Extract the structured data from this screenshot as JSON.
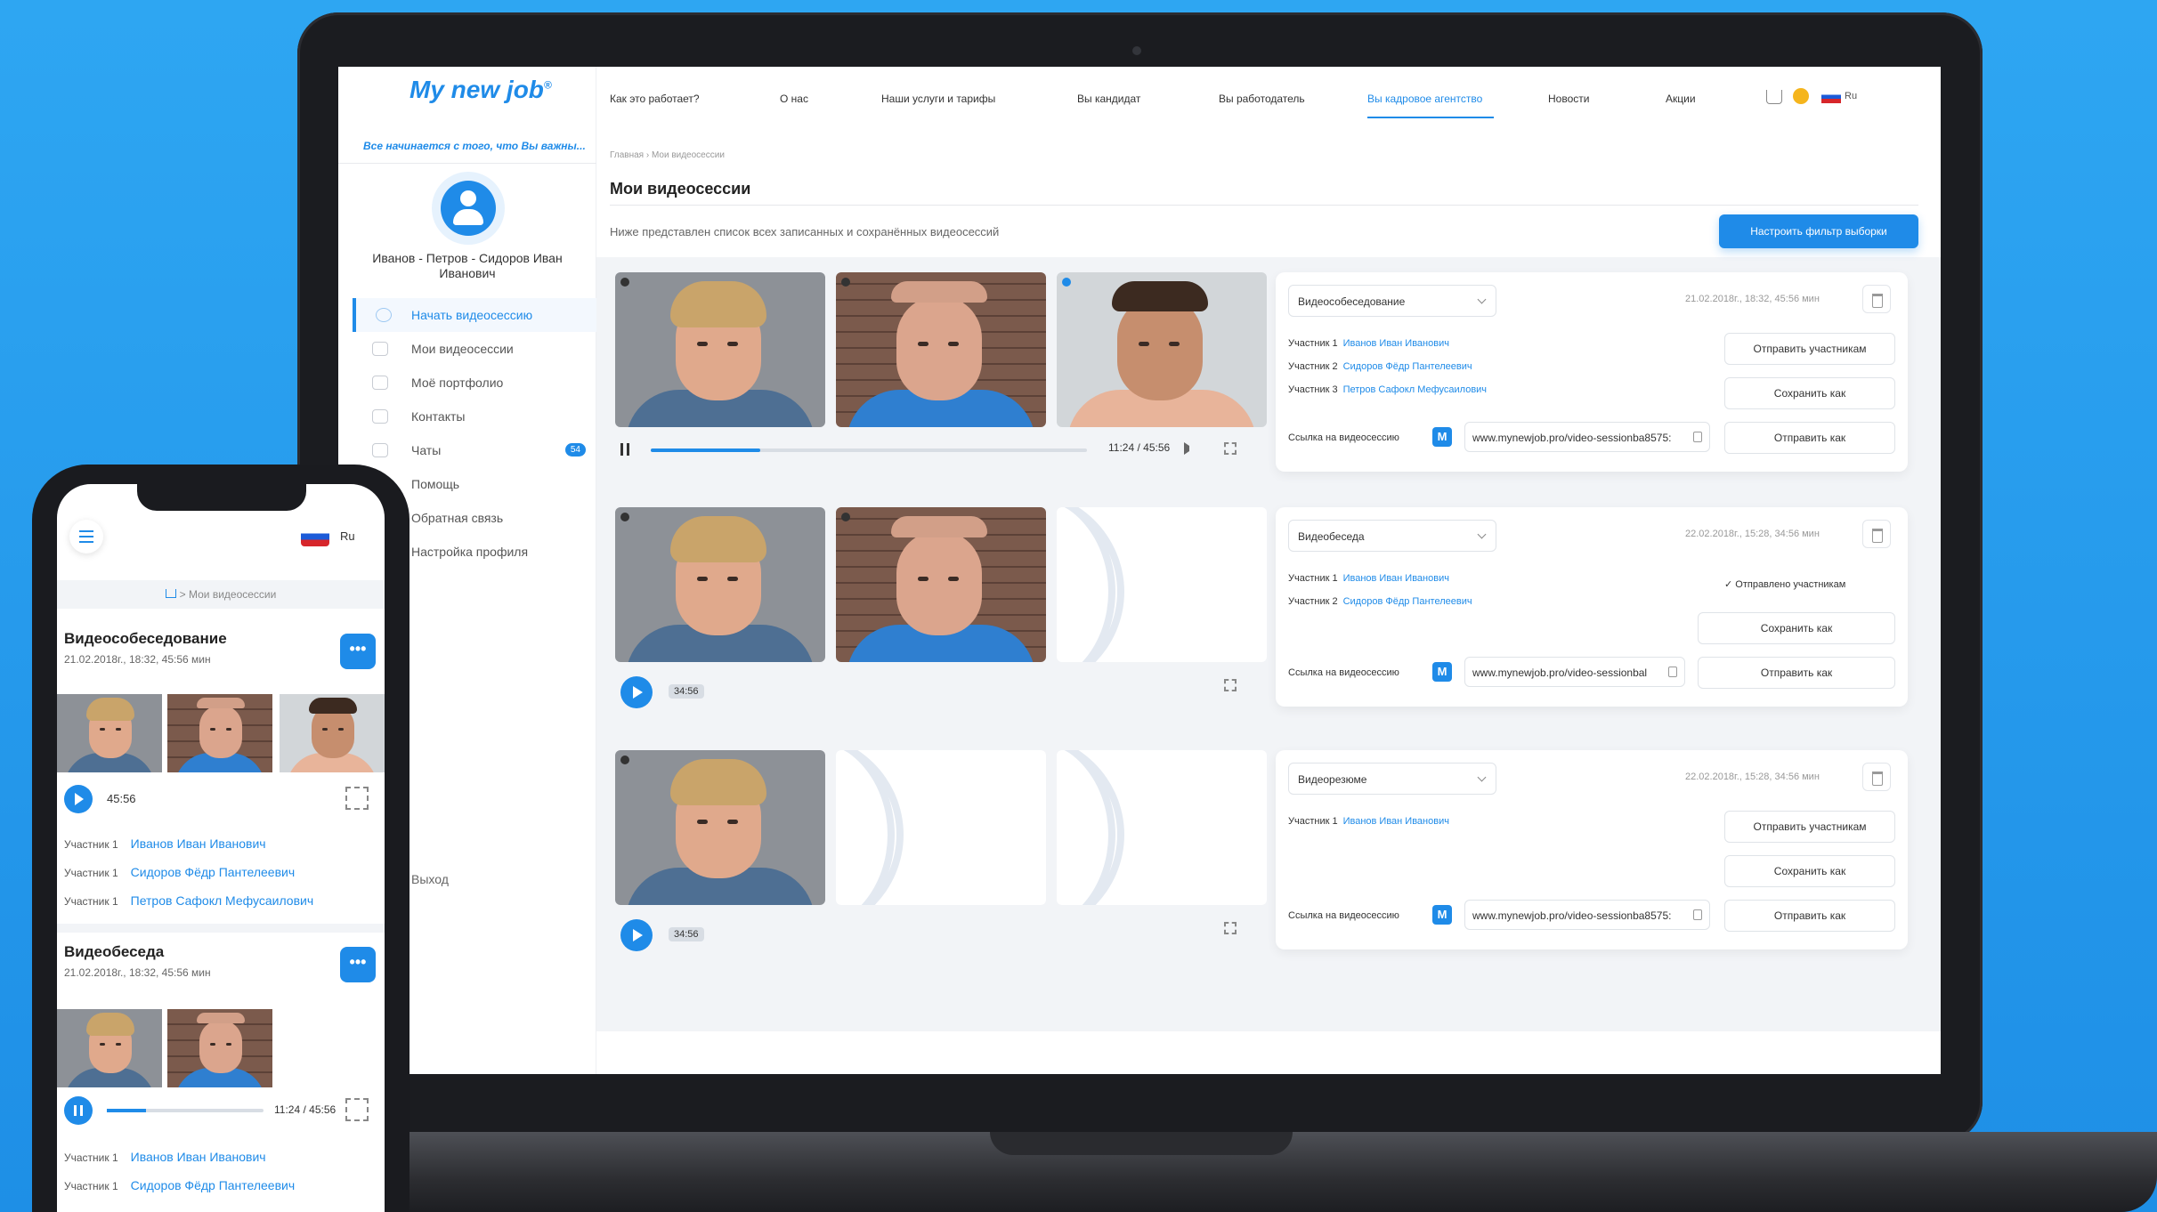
{
  "site": {
    "logo": "My new job",
    "slogan": "Все начинается с того, что Вы важны..."
  },
  "nav": {
    "items": [
      "Как это работает?",
      "О нас",
      "Наши услуги и тарифы",
      "Вы кандидат",
      "Вы работодатель",
      "Вы кадровое агентство",
      "Новости",
      "Акции"
    ],
    "active_index": 5,
    "lang": "Ru"
  },
  "sidebar": {
    "user_name": "Иванов - Петров - Сидоров Иван Иванович",
    "items": [
      {
        "label": "Начать видеосессию",
        "active": true
      },
      {
        "label": "Мои видеосессии"
      },
      {
        "label": "Моё портфолио"
      },
      {
        "label": "Контакты"
      },
      {
        "label": "Чаты",
        "badge": "54"
      },
      {
        "label": "Помощь"
      },
      {
        "label": "Обратная связь"
      },
      {
        "label": "Настройка профиля"
      }
    ],
    "logout": "Выход"
  },
  "page": {
    "breadcrumb": "Главная › Мои видеосессии",
    "title": "Мои видеосессии",
    "subtitle": "Ниже представлен список всех записанных и сохранённых видеосессий",
    "filter_button": "Настроить фильтр выборки"
  },
  "sessions": [
    {
      "type": "Видеособеседование",
      "date": "21.02.2018г., 18:32, 45:56 мин",
      "player": {
        "state": "playing",
        "time": "11:24 / 45:56",
        "progress": 0.25
      },
      "participants": [
        {
          "label": "Участник 1",
          "name": "Иванов Иван Иванович"
        },
        {
          "label": "Участник 2",
          "name": "Сидоров Фёдр Пантелеевич"
        },
        {
          "label": "Участник 3",
          "name": "Петров Сафокл Мефусаилович"
        }
      ],
      "link_label": "Ссылка на видеосессию",
      "link": "www.mynewjob.pro/video-sessionba8575:",
      "send_participants": "Отправить участникам",
      "save_as": "Сохранить как",
      "send_as": "Отправить как"
    },
    {
      "type": "Видеобеседа",
      "date": "22.02.2018г., 15:28, 34:56 мин",
      "player": {
        "state": "paused",
        "duration": "34:56"
      },
      "participants": [
        {
          "label": "Участник 1",
          "name": "Иванов Иван Иванович"
        },
        {
          "label": "Участник 2",
          "name": "Сидоров Фёдр Пантелеевич"
        }
      ],
      "sent_status": "✓ Отправлено участникам",
      "link_label": "Ссылка на видеосессию",
      "link": "www.mynewjob.pro/video-sessionbal",
      "save_as": "Сохранить как",
      "send_as": "Отправить как"
    },
    {
      "type": "Видеорезюме",
      "date": "22.02.2018г., 15:28, 34:56 мин",
      "player": {
        "state": "paused",
        "duration": "34:56"
      },
      "participants": [
        {
          "label": "Участник 1",
          "name": "Иванов Иван Иванович"
        }
      ],
      "link_label": "Ссылка на видеосессию",
      "link": "www.mynewjob.pro/video-sessionba8575:",
      "send_participants": "Отправить участникам",
      "save_as": "Сохранить как",
      "send_as": "Отправить как"
    }
  ],
  "mobile": {
    "lang": "Ru",
    "breadcrumb": "> Мои видеосессии",
    "cards": [
      {
        "title": "Видеособеседование",
        "date": "21.02.2018г., 18:32, 45:56 мин",
        "duration": "45:56",
        "participants": [
          {
            "label": "Участник 1",
            "name": "Иванов Иван Иванович"
          },
          {
            "label": "Участник 1",
            "name": "Сидоров Фёдр Пантелеевич"
          },
          {
            "label": "Участник 1",
            "name": "Петров Сафокл Мефусаилович"
          }
        ]
      },
      {
        "title": "Видеобеседа",
        "date": "21.02.2018г., 18:32, 45:56 мин",
        "time": "11:24 / 45:56",
        "progress": 0.25,
        "participants": [
          {
            "label": "Участник 1",
            "name": "Иванов Иван Иванович"
          },
          {
            "label": "Участник 1",
            "name": "Сидоров Фёдр Пантелеевич"
          }
        ]
      }
    ]
  },
  "colors": {
    "accent": "#1f8be8",
    "background": "#2ea6f2"
  }
}
